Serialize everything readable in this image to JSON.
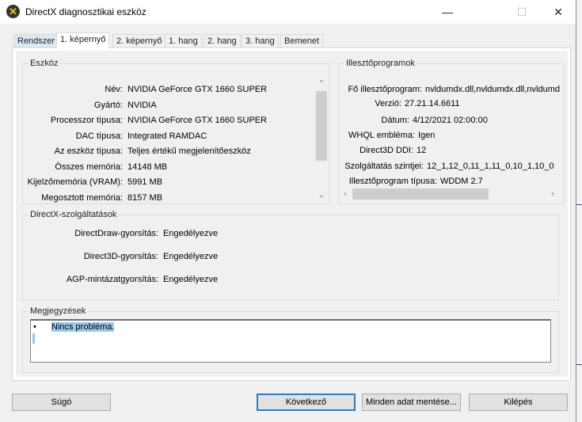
{
  "window": {
    "title": "DirectX diagnosztikai eszköz",
    "minimize": "—",
    "maximize": "☐",
    "close": "✕"
  },
  "tabs": [
    "Rendszer",
    "1. képernyő",
    "2. képernyő",
    "1. hang",
    "2. hang",
    "3. hang",
    "Bemenet"
  ],
  "device": {
    "title": "Eszköz",
    "rows": [
      {
        "label": "Név:",
        "value": "NVIDIA GeForce GTX 1660 SUPER"
      },
      {
        "label": "Gyártó:",
        "value": "NVIDIA"
      },
      {
        "label": "Processzor típusa:",
        "value": "NVIDIA GeForce GTX 1660 SUPER"
      },
      {
        "label": "DAC típusa:",
        "value": "Integrated RAMDAC"
      },
      {
        "label": "Az eszköz típusa:",
        "value": "Teljes értékű megjelenítőeszköz"
      },
      {
        "label": "Összes memória:",
        "value": "14148 MB"
      },
      {
        "label": "Kijelzőmemória (VRAM):",
        "value": "5991 MB"
      },
      {
        "label": "Megosztott memória:",
        "value": "8157 MB"
      }
    ]
  },
  "drivers": {
    "title": "Illesztőprogramok",
    "rows": [
      {
        "label": "Fő illesztőprogram:",
        "value": "nvldumdx.dll,nvldumdx.dll,nvldumd"
      },
      {
        "label": "Verzió:",
        "value": "27.21.14.6611"
      },
      {
        "label": "Dátum:",
        "value": "4/12/2021 02:00:00"
      },
      {
        "label": "WHQL embléma:",
        "value": "Igen"
      },
      {
        "label": "Direct3D DDI:",
        "value": "12"
      },
      {
        "label": "Szolgáltatás szintjei:",
        "value": "12_1,12_0,11_1,11_0,10_1,10_0"
      },
      {
        "label": "Illesztőprogram típusa:",
        "value": "WDDM 2.7"
      }
    ]
  },
  "features": {
    "title": "DirectX-szolgáltatások",
    "rows": [
      {
        "label": "DirectDraw-gyorsítás:",
        "value": "Engedélyezve"
      },
      {
        "label": "Direct3D-gyorsítás:",
        "value": "Engedélyezve"
      },
      {
        "label": "AGP-mintázatgyorsítás:",
        "value": "Engedélyezve"
      }
    ]
  },
  "notes": {
    "title": "Megjegyzések",
    "bullet": "•",
    "items": [
      "Nincs probléma."
    ]
  },
  "buttons": {
    "help": "Súgó",
    "next": "Következő",
    "save_all": "Minden adat mentése...",
    "exit": "Kilépés"
  }
}
